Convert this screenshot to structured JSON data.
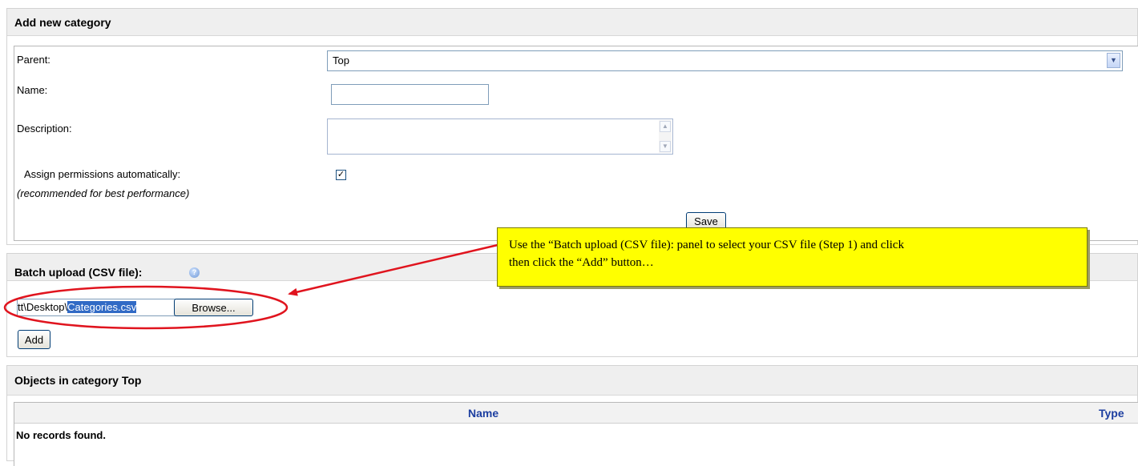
{
  "add_category": {
    "title": "Add new category",
    "parent_label": "Parent:",
    "parent_value": "Top",
    "name_label": "Name:",
    "name_value": "",
    "description_label": "Description:",
    "assign_label": "Assign permissions automatically:",
    "assign_note": "(recommended for best performance)",
    "assign_checked": true,
    "save_label": "Save"
  },
  "batch_upload": {
    "title": "Batch upload (CSV file):",
    "help_icon": "help-icon",
    "file_path_prefix": "tt\\Desktop\\",
    "file_path_selected": "Categories.csv",
    "browse_label": "Browse...",
    "add_label": "Add"
  },
  "objects": {
    "title": "Objects in category Top",
    "columns": [
      "Name",
      "Type"
    ],
    "empty_message": "No records found."
  },
  "callout": {
    "line1": "Use the “Batch upload (CSV file): panel to select your CSV file (Step 1) and click",
    "line2": "then click the “Add” button…",
    "color": "#ffff00",
    "annotation_color": "#e0141e"
  }
}
